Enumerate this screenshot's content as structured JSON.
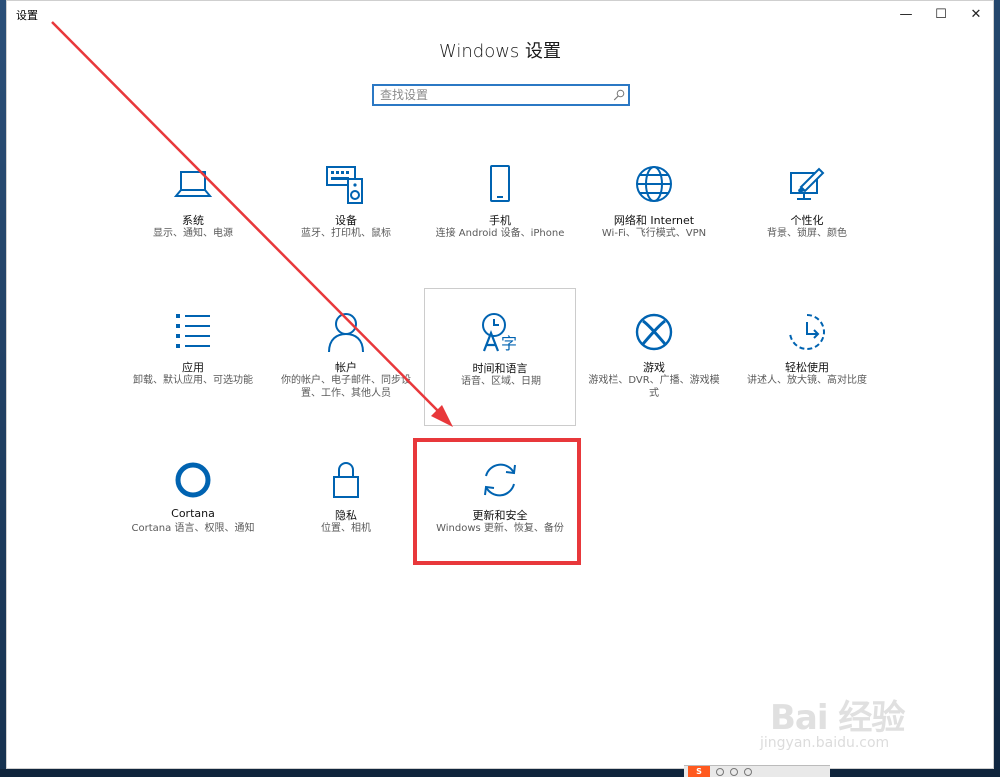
{
  "window": {
    "app_title": "设置",
    "minimize": "—",
    "maximize": "☐",
    "close": "✕"
  },
  "page": {
    "title": "Windows 设置"
  },
  "search": {
    "placeholder": "查找设置",
    "value": ""
  },
  "tiles": [
    {
      "icon": "laptop-icon",
      "label": "系统",
      "desc": "显示、通知、电源"
    },
    {
      "icon": "keyboard-speaker-icon",
      "label": "设备",
      "desc": "蓝牙、打印机、鼠标"
    },
    {
      "icon": "phone-icon",
      "label": "手机",
      "desc": "连接 Android 设备、iPhone"
    },
    {
      "icon": "globe-icon",
      "label": "网络和 Internet",
      "desc": "Wi-Fi、飞行模式、VPN"
    },
    {
      "icon": "paintbrush-icon",
      "label": "个性化",
      "desc": "背景、锁屏、颜色"
    },
    {
      "icon": "apps-list-icon",
      "label": "应用",
      "desc": "卸载、默认应用、可选功能"
    },
    {
      "icon": "person-icon",
      "label": "帐户",
      "desc": "你的帐户、电子邮件、同步设置、工作、其他人员"
    },
    {
      "icon": "time-language-icon",
      "label": "时间和语言",
      "desc": "语音、区域、日期"
    },
    {
      "icon": "xbox-icon",
      "label": "游戏",
      "desc": "游戏栏、DVR、广播、游戏模式"
    },
    {
      "icon": "ease-of-access-icon",
      "label": "轻松使用",
      "desc": "讲述人、放大镜、高对比度"
    },
    {
      "icon": "cortana-icon",
      "label": "Cortana",
      "desc": "Cortana 语言、权限、通知"
    },
    {
      "icon": "lock-icon",
      "label": "隐私",
      "desc": "位置、相机"
    },
    {
      "icon": "sync-icon",
      "label": "更新和安全",
      "desc": "Windows 更新、恢复、备份"
    }
  ],
  "watermark": {
    "logo": "Bai 经验",
    "url": "jingyan.baidu.com"
  },
  "tray": {
    "app_logo": "S"
  },
  "colors": {
    "accent": "#0063b1",
    "highlight": "#e8383b",
    "search_border": "#2b78c4"
  }
}
